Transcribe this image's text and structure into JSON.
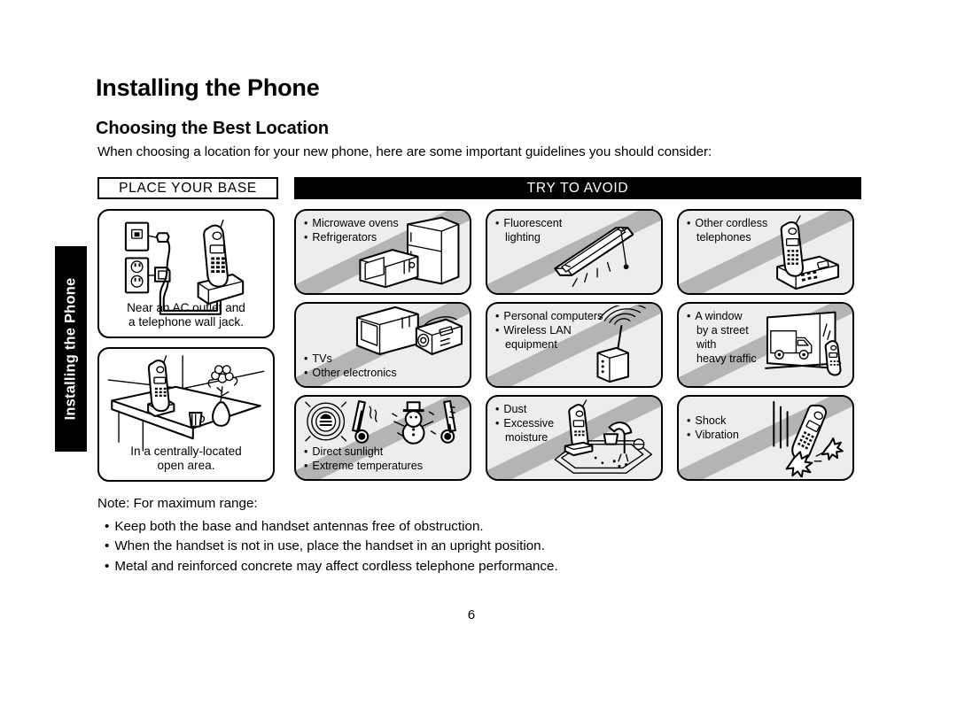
{
  "chapter_tab": {
    "label": "Installing the Phone"
  },
  "page": {
    "title": "Installing the Phone",
    "subtitle": "Choosing the Best Location",
    "intro": "When choosing a location for your new phone, here are some important guidelines you should consider:",
    "page_number": "6"
  },
  "headers": {
    "place_your_base": "PLACE YOUR BASE",
    "try_to_avoid": "TRY TO AVOID"
  },
  "place_your_base": {
    "panels": [
      {
        "caption_line1": "Near an AC outlet and",
        "caption_line2": "a telephone wall jack.",
        "art": "base-with-ac-outlet-and-wall-jack"
      },
      {
        "caption_line1": "In a centrally-located",
        "caption_line2": "open area.",
        "art": "phone-on-table-in-open-room"
      }
    ]
  },
  "try_to_avoid": {
    "panels": [
      {
        "lines": [
          "Microwave ovens",
          "Refrigerators"
        ],
        "text_position": "top",
        "art": "microwave-and-refrigerator"
      },
      {
        "lines": [
          "Fluorescent",
          "lighting"
        ],
        "text_position": "top",
        "art": "fluorescent-light-fixture"
      },
      {
        "lines": [
          "Other cordless",
          "telephones"
        ],
        "text_position": "top",
        "art": "cordless-telephone-and-base"
      },
      {
        "lines": [
          "TVs",
          "Other electronics"
        ],
        "text_position": "bottom",
        "art": "television-and-radio"
      },
      {
        "lines": [
          "Personal computers",
          "Wireless LAN",
          "equipment"
        ],
        "text_position": "top",
        "art": "wireless-router-with-signal-waves"
      },
      {
        "lines": [
          "A window",
          "by a street",
          "with",
          "heavy traffic"
        ],
        "text_position": "top",
        "art": "window-with-truck-and-phone"
      },
      {
        "lines": [
          "Direct sunlight",
          "Extreme temperatures"
        ],
        "text_position": "bottom",
        "art": "sun-thermometers-and-snowman"
      },
      {
        "lines": [
          "Dust",
          "Excessive",
          "moisture"
        ],
        "text_position": "top",
        "art": "phone-near-kitchen-sink"
      },
      {
        "lines": [
          "Shock",
          "Vibration"
        ],
        "text_position": "top",
        "art": "phone-falling-and-impact"
      }
    ]
  },
  "notes": {
    "heading": "Note:  For maximum range:",
    "items": [
      "Keep both the base and handset antennas free of obstruction.",
      "When the handset is not in use, place the handset in an upright position.",
      "Metal and reinforced concrete may affect cordless telephone performance."
    ]
  },
  "colors": {
    "panel_fill": "#ededed",
    "slash_gray": "#b4b4b4",
    "bar_black": "#000000",
    "text": "#000000"
  }
}
